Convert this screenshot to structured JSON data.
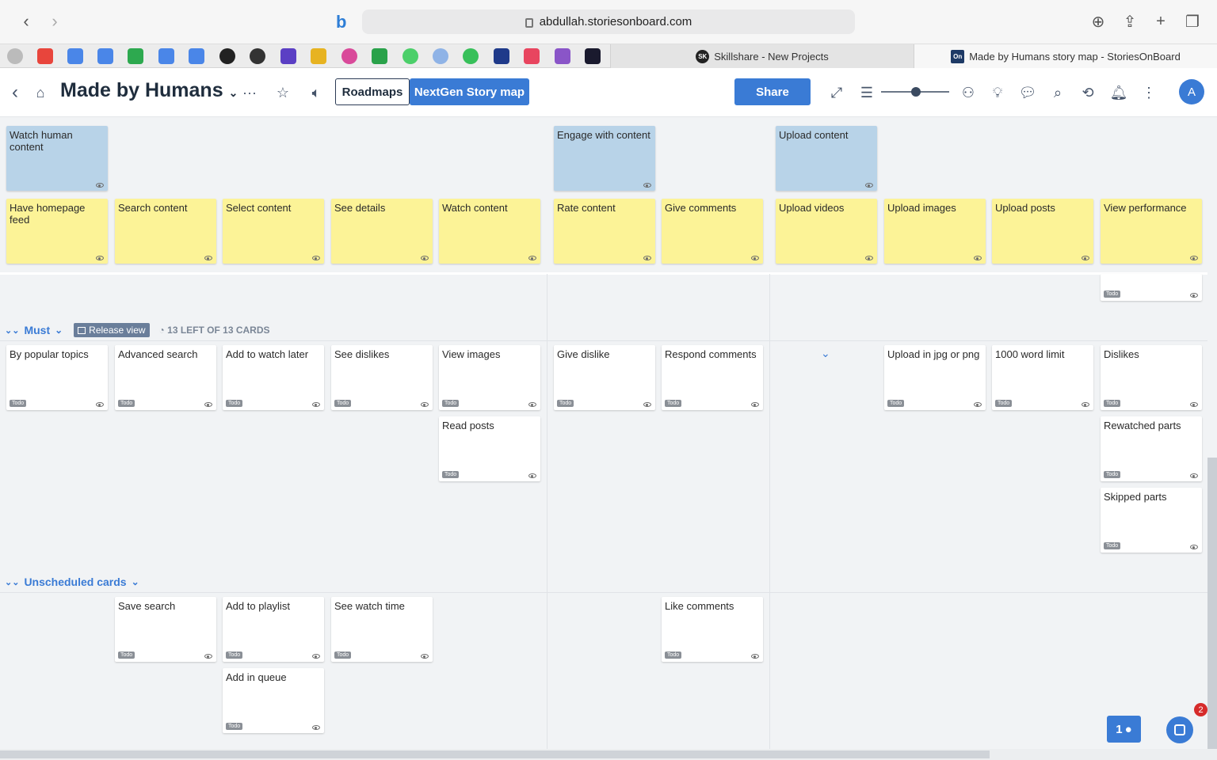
{
  "browser": {
    "url": "abdullah.storiesonboard.com",
    "tabs": [
      {
        "label": "Skillshare - New Projects",
        "favicon": "SK"
      },
      {
        "label": "Made by Humans story map - StoriesOnBoard",
        "favicon": "On"
      }
    ]
  },
  "header": {
    "title": "Made by Humans",
    "roadmaps_label": "Roadmaps",
    "nextgen_label": "NextGen Story map",
    "share_label": "Share",
    "avatar_letter": "A"
  },
  "activities": [
    {
      "label": "Watch human content"
    },
    {
      "label": "Engage with content"
    },
    {
      "label": "Upload content"
    }
  ],
  "tasks": [
    {
      "label": "Have homepage feed"
    },
    {
      "label": "Search content"
    },
    {
      "label": "Select content"
    },
    {
      "label": "See details"
    },
    {
      "label": "Watch content"
    },
    {
      "label": "Rate content"
    },
    {
      "label": "Give comments"
    },
    {
      "label": "Upload videos"
    },
    {
      "label": "Upload images"
    },
    {
      "label": "Upload posts"
    },
    {
      "label": "View performance"
    }
  ],
  "status_label": "Todo",
  "release": {
    "name": "Must",
    "view_label": "Release view",
    "count_label": "13 LEFT OF 13 CARDS",
    "cards": [
      {
        "label": "By popular topics"
      },
      {
        "label": "Advanced search"
      },
      {
        "label": "Add to watch later"
      },
      {
        "label": "See dislikes"
      },
      {
        "label": "View images"
      },
      {
        "label": "Read posts"
      },
      {
        "label": "Give dislike"
      },
      {
        "label": "Respond comments"
      },
      {
        "label": "Upload in jpg or png"
      },
      {
        "label": "1000 word limit"
      },
      {
        "label": "Dislikes"
      },
      {
        "label": "Rewatched parts"
      },
      {
        "label": "Skipped parts"
      }
    ]
  },
  "unscheduled": {
    "name": "Unscheduled cards",
    "cards": [
      {
        "label": "Save search"
      },
      {
        "label": "Add to playlist"
      },
      {
        "label": "Add in queue"
      },
      {
        "label": "See watch time"
      },
      {
        "label": "Like comments"
      }
    ]
  },
  "fab": {
    "user_count": "1",
    "notification_count": "2"
  },
  "colors": {
    "accent": "#3a7bd5",
    "activity": "#b8d3e8",
    "task": "#fcf397"
  }
}
